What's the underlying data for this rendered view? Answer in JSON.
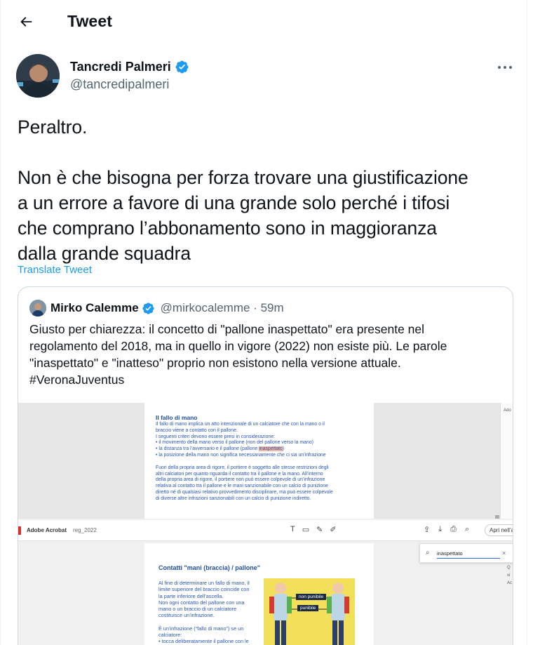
{
  "header": {
    "title": "Tweet"
  },
  "tweet": {
    "author_name": "Tancredi Palmeri",
    "author_handle": "@tancredipalmeri",
    "paragraph_1": "Peraltro.",
    "paragraph_2_line_1": "Non è che bisogna per forza trovare una giustificazione",
    "paragraph_2_line_2": "a un errore a favore di una grande solo perché i tifosi",
    "paragraph_2_line_3": "che comprano l’abbonamento sono in maggioranza",
    "paragraph_2_line_4": "dalla grande squadra",
    "translate_label": "Translate Tweet"
  },
  "quote": {
    "author_name": "Mirko Calemme",
    "author_handle": "@mirkocalemme",
    "separator": " · ",
    "time": "59m",
    "text_line_1": "Giusto per chiarezza: il concetto di \"pallone inaspettato\" era presente nel",
    "text_line_2": "regolamento del 2018, ma in quello in vigore (2022) non esiste più. Le parole",
    "text_line_3": "\"inaspettato\" e \"inatteso\" proprio non esistono nella versione attuale.",
    "text_line_4": "#VeronaJuventus"
  },
  "quote_image": {
    "doc_top": {
      "heading": "Il fallo di mano",
      "l1": "Il fallo di mano implica un atto intenzionale di un calciatore che con la mano o il",
      "l2": "braccio viene a contatto con il pallone.",
      "l3": "I seguenti criteri devono essere presi in considerazione:",
      "l4": "• il movimento della mano verso il pallone (non del pallone verso la mano)",
      "l5_pre": "• la distanza tra l’avversario e il pallone (pallone ",
      "l5_hl": "inaspettato",
      "l5_post": ")",
      "l6": "• la posizione della mano non significa necessariamente che ci sia un’infrazione",
      "l7": "Fuori della propria area di rigore, il portiere è soggetto alle stesse restrizioni degli",
      "l8": "altri calciatori per quanto riguarda il contatto tra il pallone e la mano. All’interno",
      "l9": "della propria area di rigore, il portiere non può essere colpevole di un’infrazione",
      "l10": "relativa al contatto tra il pallone e le mani sanzionabile con un calcio di punizione",
      "l11": "diretto né di qualsiasi relativo provvedimento disciplinare, ma può essere colpevole",
      "l12": "di diverse altre infrazioni sanzionabili con un calcio di punizione indiretto."
    },
    "side_top": "Ado",
    "toolbar": {
      "app_name": "Adobe Acrobat",
      "file_name": "reg_2022",
      "open_app": "Apri nell’ap"
    },
    "search": {
      "value": "inaspettato"
    },
    "side_letters": [
      "Q",
      "vi",
      "Ac"
    ],
    "doc_bottom": {
      "heading": "Contatti \"mani (braccia) / pallone\"",
      "b1": "Al fine di determinare un fallo di mano, il",
      "b2": "limite superiore del braccio coincide con",
      "b3": "la parte inferiore dell’ascella.",
      "b4": "Non ogni contatto del pallone con una",
      "b5": "mano o un braccio di un calciatore",
      "b6": "costituisce un’infrazione.",
      "b7": "È un’infrazione (“fallo di mano”) se un",
      "b8": "calciatore:",
      "b9": "• tocca deliberatamente il pallone con le",
      "label_a": "non punibile",
      "label_b": "punibile"
    }
  },
  "colors": {
    "accent": "#1d9bf0",
    "secondary_text": "#536471"
  },
  "icons": [
    "back-arrow-icon",
    "verified-badge-icon",
    "more-dots-icon"
  ]
}
